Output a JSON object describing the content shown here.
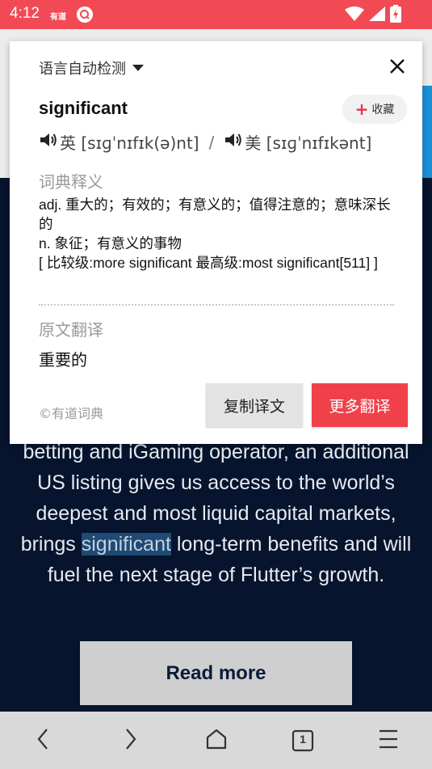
{
  "status_bar": {
    "time": "4:12",
    "app_label": "有道",
    "icons": [
      "search-icon",
      "wifi-icon",
      "signal-icon",
      "battery-charging-icon"
    ],
    "color": "#f24a54"
  },
  "popup": {
    "language_detect": "语言自动检测",
    "word": "significant",
    "favorite_label": "收藏",
    "phonetic_uk": "英 [sɪɡˈnɪfɪk(ə)nt]",
    "phonetic_sep": "/",
    "phonetic_us": "美 [sɪɡˈnɪfɪkənt]",
    "dict_heading": "词典释义",
    "definitions": [
      "adj. 重大的；有效的；有意义的；值得注意的；意味深长的",
      "n. 象征；有意义的事物",
      "[ 比较级:more significant 最高级:most significant[511] ]"
    ],
    "orig_heading": "原文翻译",
    "translation": "重要的",
    "credit": "©有道词典",
    "copy_button": "复制译文",
    "more_button": "更多翻译",
    "accent_color": "#f0414b"
  },
  "page": {
    "article_before": "betting and iGaming operator, an additional US listing gives us access to the world’s deepest and most liquid capital markets, brings ",
    "article_highlight": "significant",
    "article_after": " long-term benefits and will fuel the next stage of Flutter’s growth.",
    "read_more": "Read more",
    "background_color": "#06142e"
  },
  "browser_nav": {
    "tab_count": "1",
    "icons": [
      "back-icon",
      "forward-icon",
      "home-icon",
      "tabs-icon",
      "menu-icon"
    ]
  }
}
